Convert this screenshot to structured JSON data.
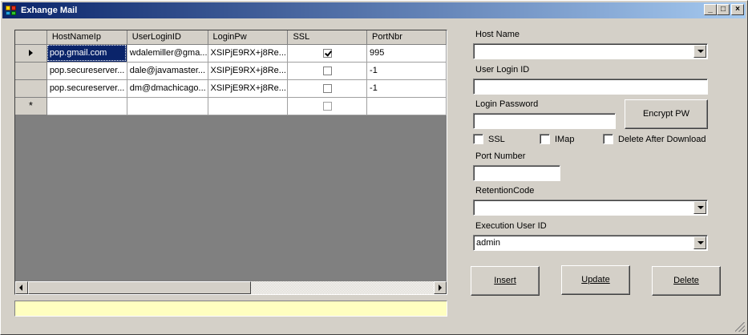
{
  "window": {
    "title": "Exhange Mail"
  },
  "grid": {
    "columns": [
      "HostNameIp",
      "UserLoginID",
      "LoginPw",
      "SSL",
      "PortNbr"
    ],
    "rows": [
      {
        "host": "pop.gmail.com",
        "user": "wdalemiller@gma...",
        "pw": "XSIPjE9RX+j8Re...",
        "ssl": true,
        "port": "995"
      },
      {
        "host": "pop.secureserver...",
        "user": "dale@javamaster...",
        "pw": "XSIPjE9RX+j8Re...",
        "ssl": false,
        "port": "-1"
      },
      {
        "host": "pop.secureserver...",
        "user": "dm@dmachicago...",
        "pw": "XSIPjE9RX+j8Re...",
        "ssl": false,
        "port": "-1"
      }
    ]
  },
  "status": {
    "text": ""
  },
  "form": {
    "host_label": "Host Name",
    "host_value": "",
    "user_label": "User Login ID",
    "user_value": "",
    "pw_label": "Login Password",
    "pw_value": "",
    "encrypt_label": "Encrypt PW",
    "ssl_label": "SSL",
    "imap_label": "IMap",
    "delete_label": "Delete After Download",
    "port_label": "Port Number",
    "port_value": "",
    "retention_label": "RetentionCode",
    "retention_value": "",
    "exec_label": "Execution User ID",
    "exec_value": "admin"
  },
  "buttons": {
    "insert": "Insert",
    "update": "Update",
    "delete": "Delete"
  }
}
